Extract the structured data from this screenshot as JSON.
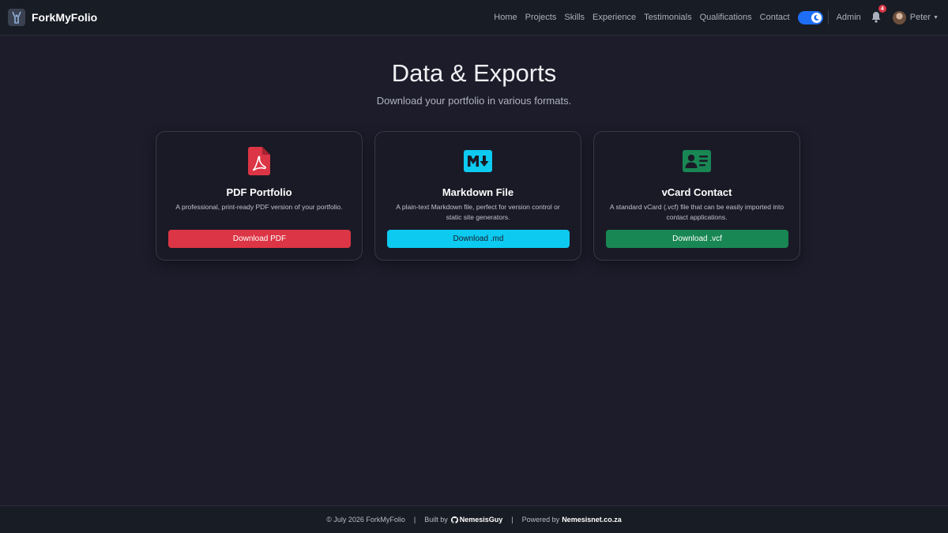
{
  "brand": {
    "name": "ForkMyFolio"
  },
  "nav": {
    "links": [
      "Home",
      "Projects",
      "Skills",
      "Experience",
      "Testimonials",
      "Qualifications",
      "Contact"
    ],
    "admin": "Admin",
    "notification_count": "4",
    "user_name": "Peter"
  },
  "header": {
    "title": "Data & Exports",
    "subtitle": "Download your portfolio in various formats."
  },
  "cards": [
    {
      "title": "PDF Portfolio",
      "description": "A professional, print-ready PDF version of your portfolio.",
      "button": "Download PDF",
      "icon": "pdf-file-icon",
      "color": "#dc3545"
    },
    {
      "title": "Markdown File",
      "description": "A plain-text Markdown file, perfect for version control or static site generators.",
      "button": "Download .md",
      "icon": "markdown-icon",
      "color": "#0dcaf0"
    },
    {
      "title": "vCard Contact",
      "description": "A standard vCard (.vcf) file that can be easily imported into contact applications.",
      "button": "Download .vcf",
      "icon": "vcard-icon",
      "color": "#198754"
    }
  ],
  "footer": {
    "copyright": "© July 2026 ForkMyFolio",
    "built_by_label": "Built by",
    "built_by_name": "NemesisGuy",
    "powered_by_label": "Powered by",
    "powered_by_name": "Nemesisnet.co.za",
    "separator": "|"
  }
}
